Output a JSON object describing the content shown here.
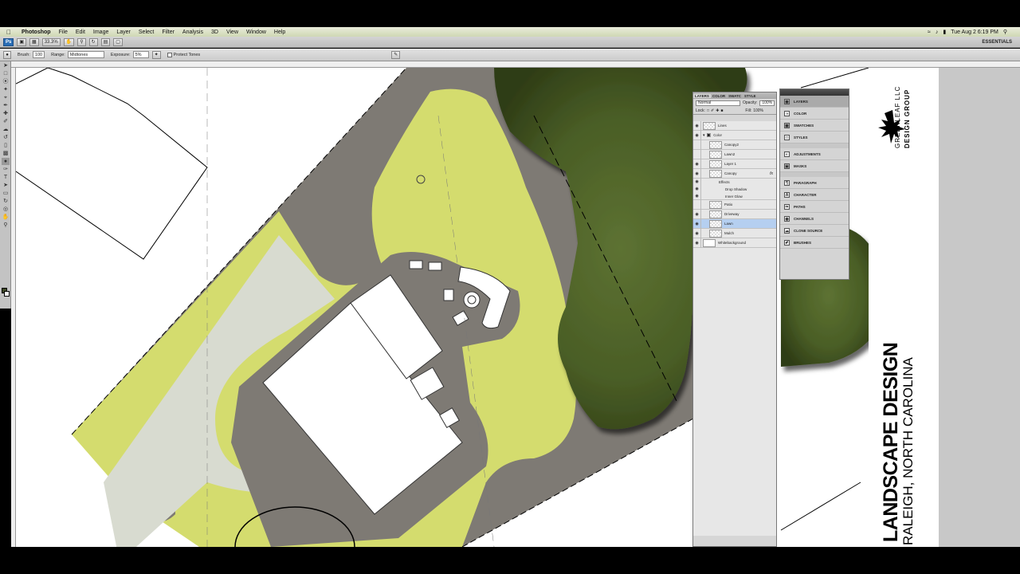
{
  "menubar": {
    "items": [
      "Photoshop",
      "File",
      "Edit",
      "Image",
      "Layer",
      "Select",
      "Filter",
      "Analysis",
      "3D",
      "View",
      "Window",
      "Help"
    ],
    "clock": "Tue Aug 2  6:19 PM"
  },
  "appbar": {
    "ps_label": "Ps",
    "zoom": "33.3%",
    "workspace": "ESSENTIALS"
  },
  "options": {
    "brush_label": "Brush:",
    "brush_size": "100",
    "range_label": "Range:",
    "range_value": "Midtones",
    "exposure_label": "Exposure:",
    "exposure_value": "5%",
    "protect_label": "Protect Tones"
  },
  "layers_panel": {
    "tabs": [
      "LAYERS",
      "COLOR",
      "SWATC",
      "STYLE"
    ],
    "blend_mode": "Normal",
    "opacity_label": "Opacity:",
    "opacity_value": "100%",
    "lock_label": "Lock:",
    "fill_label": "Fill:",
    "fill_value": "100%",
    "layers": [
      {
        "name": "Lines",
        "visible": true,
        "kind": "layer"
      },
      {
        "name": "Color",
        "visible": true,
        "kind": "group"
      },
      {
        "name": "Canopy2",
        "visible": false,
        "kind": "layer"
      },
      {
        "name": "Lawn2",
        "visible": false,
        "kind": "layer"
      },
      {
        "name": "Layer 1",
        "visible": true,
        "kind": "layer"
      },
      {
        "name": "Canopy",
        "visible": true,
        "kind": "layer",
        "fx": "fx"
      },
      {
        "name": "Effects",
        "visible": true,
        "kind": "effects"
      },
      {
        "name": "Drop Shadow",
        "visible": true,
        "kind": "effect"
      },
      {
        "name": "Inner Glow",
        "visible": true,
        "kind": "effect"
      },
      {
        "name": "Patio",
        "visible": false,
        "kind": "layer"
      },
      {
        "name": "Driveway",
        "visible": true,
        "kind": "layer"
      },
      {
        "name": "Lawn",
        "visible": true,
        "kind": "layer",
        "selected": true
      },
      {
        "name": "Mulch",
        "visible": true,
        "kind": "layer"
      },
      {
        "name": "Whitebackground",
        "visible": true,
        "kind": "layer"
      }
    ]
  },
  "dock": {
    "items": [
      "LAYERS",
      "COLOR",
      "SWATCHES",
      "STYLES",
      "ADJUSTMENTS",
      "MASKS",
      "PARAGRAPH",
      "CHARACTER",
      "PATHS",
      "CHANNELS",
      "CLONE SOURCE",
      "BRUSHES"
    ]
  },
  "titleblock": {
    "title": "LANDSCAPE DESIGN",
    "subtitle": "RALEIGH, NORTH CAROLINA",
    "logo_line1": "GREENLEAF LLC",
    "logo_line2": "DESIGN GROUP",
    "colors": {
      "lawn": "#d4dc6e",
      "driveway": "#7e7a74",
      "canopy": "#4a5e26",
      "walk": "#d8dbd0"
    }
  }
}
